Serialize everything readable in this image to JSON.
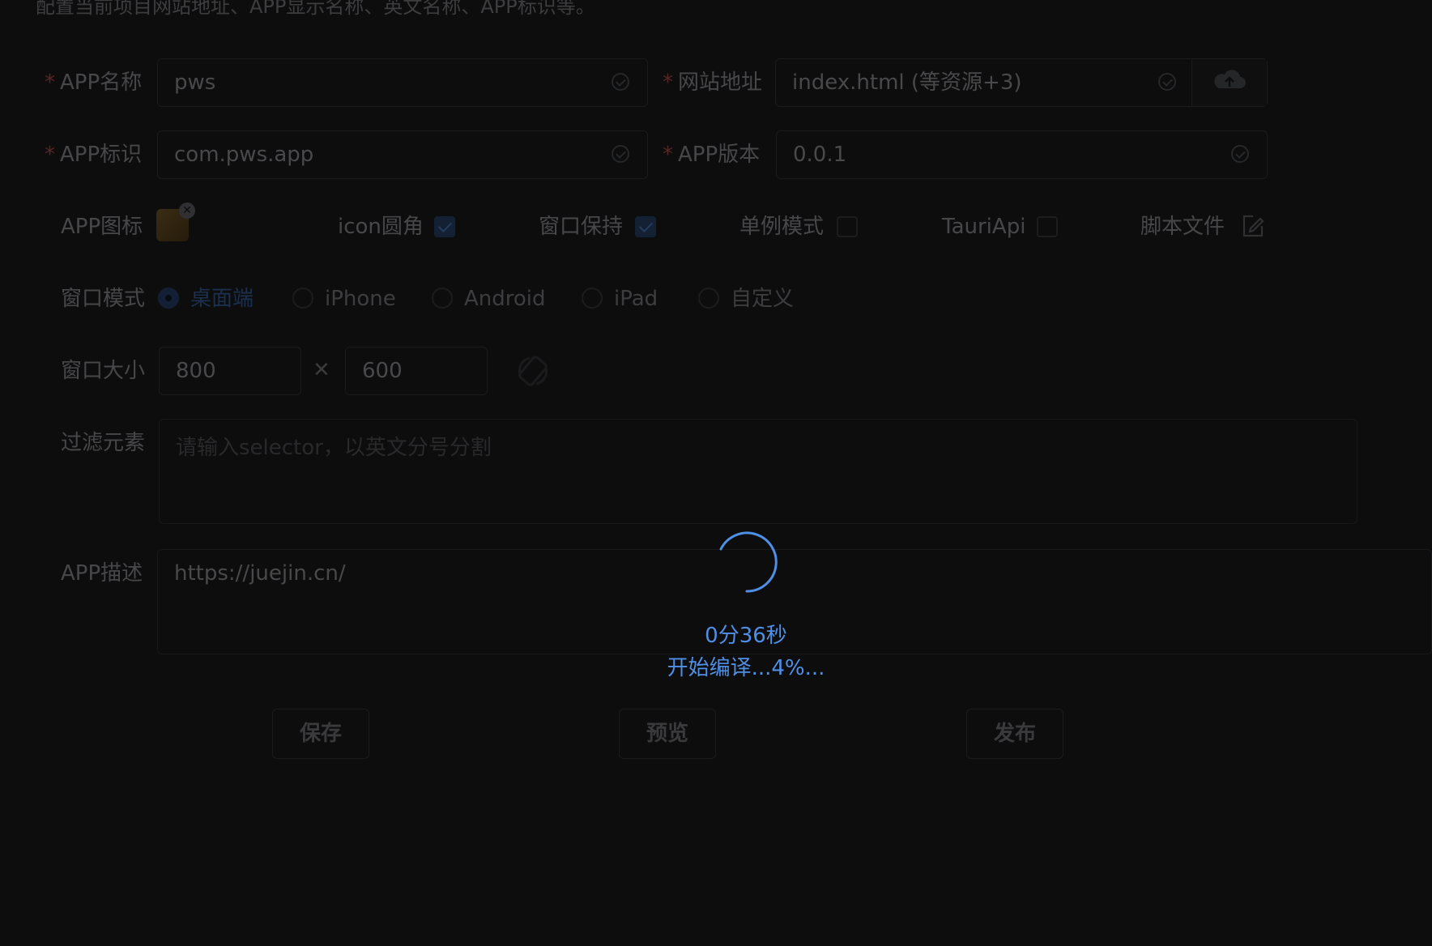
{
  "page": {
    "description": "配置当前项目网站地址、APP显示名称、英文名称、APP标识等。"
  },
  "form": {
    "app_name": {
      "label": "APP名称",
      "required_mark": "*",
      "value": "pws"
    },
    "website": {
      "label": "网站地址",
      "required_mark": "*",
      "value": "index.html (等资源+3)",
      "append_icon": "cloud-upload-icon"
    },
    "app_id": {
      "label": "APP标识",
      "required_mark": "*",
      "value": "com.pws.app"
    },
    "app_version": {
      "label": "APP版本",
      "required_mark": "*",
      "value": "0.0.1"
    },
    "app_icon": {
      "label": "APP图标"
    },
    "options": [
      {
        "label": "icon圆角",
        "checked": true
      },
      {
        "label": "窗口保持",
        "checked": true
      },
      {
        "label": "单例模式",
        "checked": false
      },
      {
        "label": "TauriApi",
        "checked": false
      }
    ],
    "script_file": {
      "label": "脚本文件",
      "icon": "edit-icon"
    },
    "window_mode": {
      "label": "窗口模式",
      "options": [
        "桌面端",
        "iPhone",
        "Android",
        "iPad",
        "自定义"
      ],
      "selected": "桌面端"
    },
    "window_size": {
      "label": "窗口大小",
      "width": "800",
      "separator": "✕",
      "height": "600",
      "rotate_icon": "rotate-icon"
    },
    "filter": {
      "label": "过滤元素",
      "placeholder": "请输入selector，以英文分号分割"
    },
    "description": {
      "label": "APP描述",
      "value": "https://juejin.cn/"
    }
  },
  "buttons": {
    "save": "保存",
    "preview": "预览",
    "publish": "发布"
  },
  "loading": {
    "timer": "0分36秒",
    "status": "开始编译...4%..."
  },
  "colors": {
    "accent": "#4f8fe6",
    "background": "#141415"
  }
}
